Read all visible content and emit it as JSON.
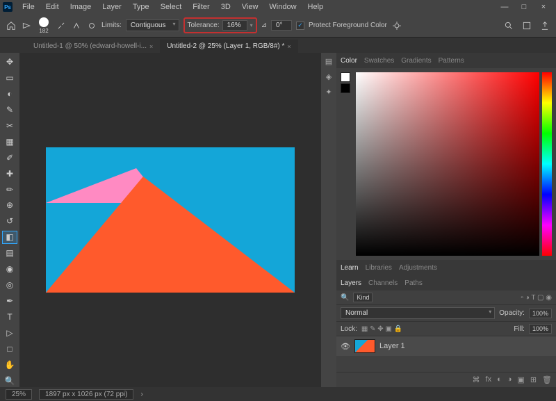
{
  "app": {
    "logo": "Ps"
  },
  "menu": [
    "File",
    "Edit",
    "Image",
    "Layer",
    "Type",
    "Select",
    "Filter",
    "3D",
    "View",
    "Window",
    "Help"
  ],
  "winctrl": {
    "min": "—",
    "max": "□",
    "close": "×"
  },
  "options": {
    "brush_size": "182",
    "limits_label": "Limits:",
    "limits_value": "Contiguous",
    "tolerance_label": "Tolerance:",
    "tolerance_value": "16%",
    "angle_label": "⊿",
    "angle_value": "0°",
    "protect_check": "✓",
    "protect_label": "Protect Foreground Color"
  },
  "tabs": [
    {
      "label": "Untitled-1 @ 50% (edward-howell-i...",
      "active": false
    },
    {
      "label": "Untitled-2 @ 25% (Layer 1, RGB/8#) *",
      "active": true
    }
  ],
  "panels": {
    "color_tabs": [
      "Color",
      "Swatches",
      "Gradients",
      "Patterns"
    ],
    "learn_tabs": [
      "Learn",
      "Libraries",
      "Adjustments"
    ],
    "layers_tabs": [
      "Layers",
      "Channels",
      "Paths"
    ],
    "kind": "Kind",
    "blend": "Normal",
    "opacity_label": "Opacity:",
    "opacity_value": "100%",
    "lock_label": "Lock:",
    "fill_label": "Fill:",
    "fill_value": "100%",
    "layer_name": "Layer 1"
  },
  "status": {
    "zoom": "25%",
    "dims": "1897 px x 1026 px (72 ppi)"
  }
}
